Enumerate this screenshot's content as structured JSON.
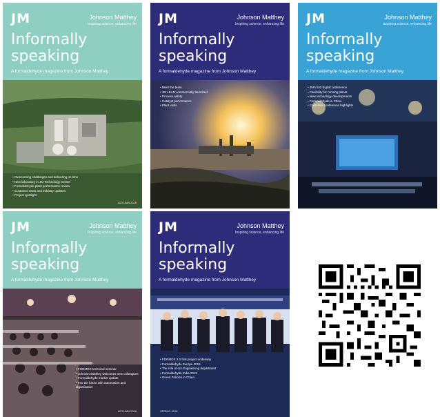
{
  "brand": {
    "mark": "JM",
    "name": "Johnson Matthey",
    "tagline": "Inspiring science, enhancing life"
  },
  "covers": [
    {
      "title_line1": "Informally",
      "title_line2": "speaking",
      "subtitle": "A formaldehyde magazine from Johnson Matthey",
      "bullets": [
        "Overcoming challenges and delivering on time",
        "New laboratory in JM Technology Centre",
        "Formaldehyde plant performance review",
        "Customer news and industry updates",
        "Project spotlight"
      ],
      "issue": "AUTUMN 2019",
      "color": "#8ecfc1"
    },
    {
      "title_line1": "Informally",
      "title_line2": "speaking",
      "subtitle": "A formaldehyde magazine from Johnson Matthey",
      "bullets": [
        "Meet the team",
        "JM LEAN commercially launched",
        "Process safety",
        "Catalyst performance",
        "Plant visits"
      ],
      "issue": "",
      "color": "#2c2c7a"
    },
    {
      "title_line1": "Informally",
      "title_line2": "speaking",
      "subtitle": "A formaldehyde magazine from Johnson Matthey",
      "bullets": [
        "JM's first digital conference",
        "Flexibility for running plants",
        "New technology developments",
        "Formaldehyde in China",
        "Customer conference highlights"
      ],
      "issue": "",
      "color": "#3aa3d5"
    },
    {
      "title_line1": "Informally",
      "title_line2": "speaking",
      "subtitle": "A formaldehyde magazine from Johnson Matthey",
      "bullets": [
        "FORMOX technical seminar",
        "Johnson Matthey welcomes new colleagues",
        "Formaldehyde market update",
        "Into the future with automation and digitalisation"
      ],
      "issue": "AUTUMN 2018",
      "color": "#8ecfc1"
    },
    {
      "title_line1": "Informally",
      "title_line2": "speaking",
      "subtitle": "A formaldehyde magazine from Johnson Matthey",
      "bullets": [
        "FORMOX 2.0 first project underway",
        "Formaldehyde Europe 2018",
        "The role of our Engineering department",
        "Formaldehyde India 2018",
        "Green Policies in China"
      ],
      "issue": "SPRING 2018",
      "color": "#2c2c7a"
    }
  ],
  "qr": {
    "label": "qr-code"
  }
}
